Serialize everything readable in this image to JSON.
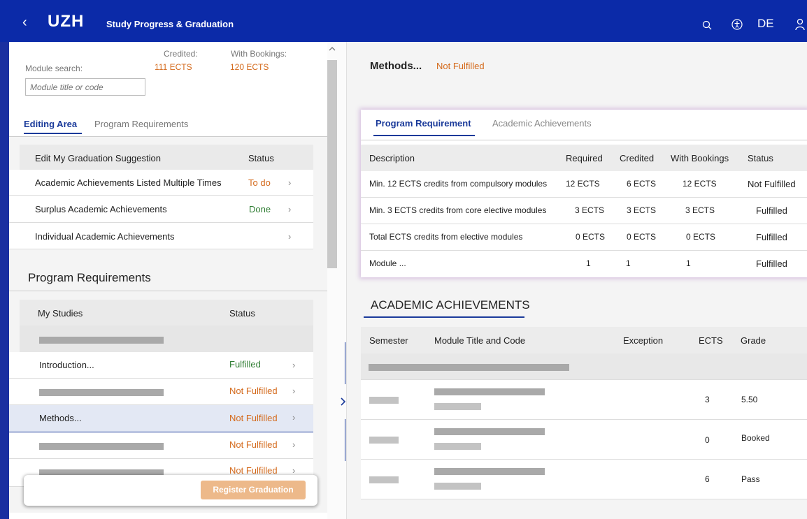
{
  "header": {
    "back_glyph": "‹",
    "logo": "UZH",
    "title": "Study Progress & Graduation",
    "lang": "DE",
    "icons": [
      "search-icon",
      "accessibility-icon",
      "user-icon"
    ]
  },
  "left": {
    "module_search_label": "Module search:",
    "module_search_placeholder": "Module title or code",
    "credited_label": "Credited:",
    "credited_value": "111 ECTS",
    "bookings_label": "With Bookings:",
    "bookings_value": "120 ECTS",
    "tabs": [
      "Editing Area",
      "Program Requirements"
    ],
    "edit_table": {
      "header_col1": "Edit My Graduation Suggestion",
      "header_col2": "Status",
      "rows": [
        {
          "label": "Academic Achievements Listed Multiple Times",
          "status": "To do"
        },
        {
          "label": "Surplus Academic Achievements",
          "status": "Done"
        },
        {
          "label": "Individual Academic Achievements",
          "status": ""
        }
      ]
    },
    "program_requirements_title": "Program Requirements",
    "studies_table": {
      "header_col1": "My Studies",
      "header_col2": "Status",
      "rows": [
        {
          "label": "",
          "status": ""
        },
        {
          "label": "Introduction...",
          "status": "Fulfilled"
        },
        {
          "label": "",
          "status": "Not Fulfilled"
        },
        {
          "label": "Methods...",
          "status": "Not Fulfilled"
        },
        {
          "label": "",
          "status": "Not Fulfilled"
        },
        {
          "label": "",
          "status": "Not Fulfilled"
        }
      ]
    },
    "register_button": "Register Graduation"
  },
  "right": {
    "title": "Methods...",
    "title_status": "Not Fulfilled",
    "tabs": [
      "Program Requirement",
      "Academic Achievements"
    ],
    "req_table": {
      "headers": [
        "Description",
        "Required",
        "Credited",
        "With Bookings",
        "Status"
      ],
      "rows": [
        {
          "desc": "Min. 12 ECTS credits from compulsory modules",
          "required": "12 ECTS",
          "credited": "6 ECTS",
          "bookings": "12 ECTS",
          "status": "Not Fulfilled"
        },
        {
          "desc": "Min. 3 ECTS credits from core elective modules",
          "required": "3 ECTS",
          "credited": "3 ECTS",
          "bookings": "3 ECTS",
          "status": "Fulfilled"
        },
        {
          "desc": "Total ECTS credits from elective modules",
          "required": "0 ECTS",
          "credited": "0 ECTS",
          "bookings": "0 ECTS",
          "status": "Fulfilled"
        },
        {
          "desc": "Module ...",
          "required": "1",
          "credited": "1",
          "bookings": "1",
          "status": "Fulfilled"
        }
      ]
    },
    "achievements_title": "ACADEMIC ACHIEVEMENTS",
    "ach_table": {
      "headers": [
        "Semester",
        "Module Title and Code",
        "Exception",
        "ECTS",
        "Grade"
      ],
      "rows": [
        {
          "ects": "3",
          "grade": "5.50"
        },
        {
          "ects": "0",
          "grade": "Booked"
        },
        {
          "ects": "6",
          "grade": "Pass"
        }
      ]
    }
  }
}
